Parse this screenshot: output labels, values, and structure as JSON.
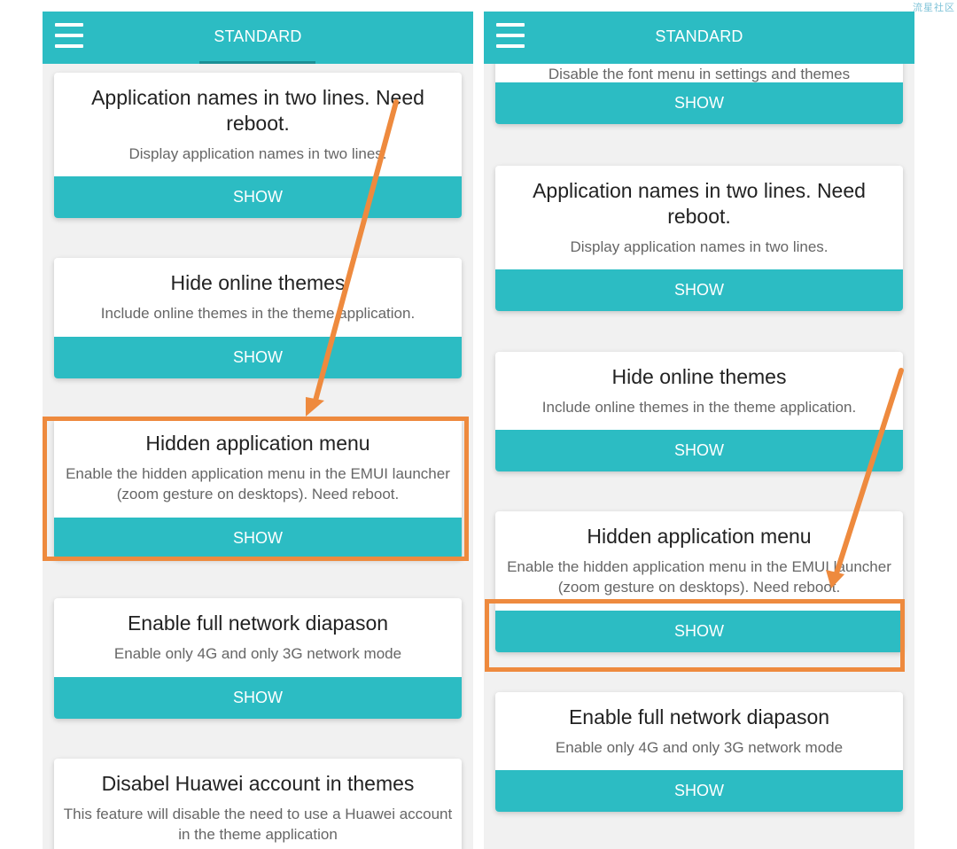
{
  "watermark": "流星社区",
  "appbar": {
    "title": "STANDARD"
  },
  "cards": {
    "font_desc": "Disable the font menu in settings and themes",
    "app_names": {
      "title": "Application names in two lines. Need reboot.",
      "desc": "Display application names in two lines."
    },
    "hide_themes": {
      "title": "Hide online themes",
      "desc": "Include online themes in the theme application."
    },
    "hidden_menu": {
      "title": "Hidden application menu",
      "desc": "Enable the hidden application menu in the EMUI launcher (zoom gesture on desktops). Need reboot."
    },
    "network": {
      "title": "Enable full network diapason",
      "desc": "Enable only 4G and only 3G network mode"
    },
    "huawei_account": {
      "title": "Disabel Huawei account in themes",
      "desc": "This feature will disable the need to use a Huawei account in the theme application"
    }
  },
  "button_label": "SHOW",
  "colors": {
    "accent": "#2cbcc3",
    "annotation": "#ee8a3e"
  }
}
